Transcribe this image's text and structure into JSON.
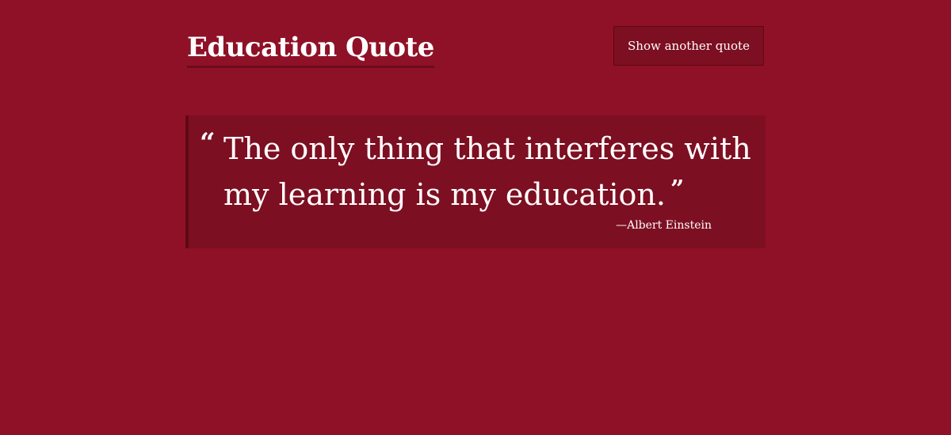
{
  "header": {
    "title": "Education Quote",
    "button_label": "Show another quote"
  },
  "quote": {
    "open_mark": "“",
    "text": "The only thing that interferes with my learning is my education.",
    "close_mark": "”",
    "author": "—Albert Einstein"
  },
  "colors": {
    "background": "#8f1127",
    "card": "#7d0f22",
    "accent_border": "#5e0816",
    "text": "#ffffff"
  }
}
